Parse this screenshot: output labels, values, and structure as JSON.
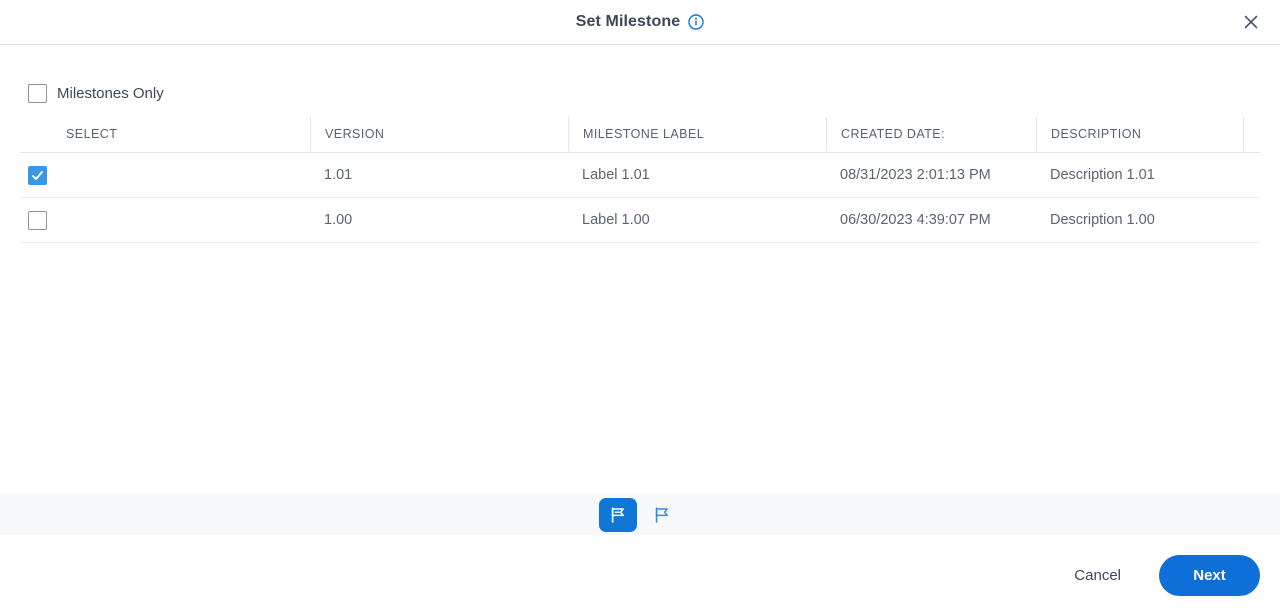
{
  "header": {
    "title": "Set Milestone",
    "info_icon": "info-circle-icon",
    "close_icon": "close-x-icon"
  },
  "filter": {
    "milestones_only_label": "Milestones Only",
    "milestones_only_checked": false
  },
  "table": {
    "columns": [
      {
        "key": "select",
        "label": "SELECT"
      },
      {
        "key": "version",
        "label": "VERSION"
      },
      {
        "key": "milestone_label",
        "label": "MILESTONE LABEL"
      },
      {
        "key": "created_date",
        "label": "CREATED DATE:"
      },
      {
        "key": "description",
        "label": "DESCRIPTION"
      }
    ],
    "rows": [
      {
        "selected": true,
        "version": "1.01",
        "milestone_label": "Label 1.01",
        "created_date": "08/31/2023 2:01:13 PM",
        "description": "Description 1.01"
      },
      {
        "selected": false,
        "version": "1.00",
        "milestone_label": "Label 1.00",
        "created_date": "06/30/2023 4:39:07 PM",
        "description": "Description 1.00"
      }
    ]
  },
  "toolbar": {
    "items": [
      {
        "icon": "flag-filled-icon",
        "active": true
      },
      {
        "icon": "flag-outline-icon",
        "active": false
      }
    ]
  },
  "footer": {
    "cancel_label": "Cancel",
    "next_label": "Next"
  },
  "colors": {
    "accent_blue": "#1177d6",
    "primary_button": "#0f6fd8",
    "checkbox_checked": "#3a97e6",
    "toolbar_band": "#f8f9fb",
    "text_primary": "#3c4858",
    "text_secondary": "#5a6472",
    "divider": "#e3e5e8"
  }
}
